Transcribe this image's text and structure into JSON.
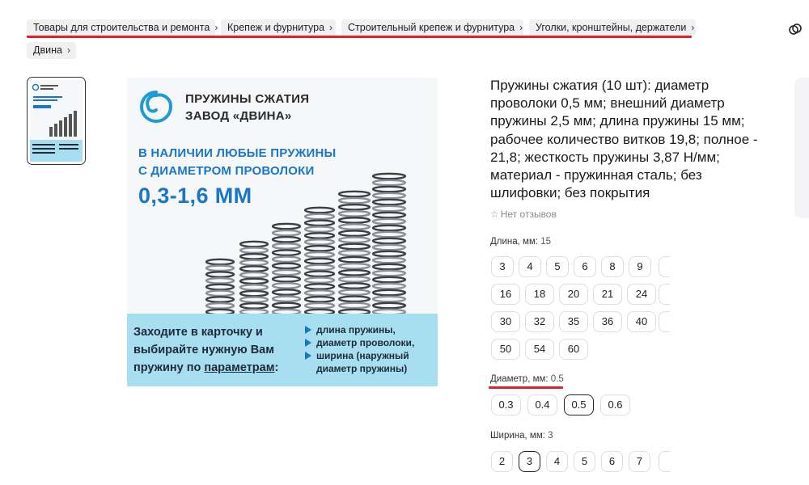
{
  "breadcrumbs": [
    {
      "label": "Товары для строительства и ремонта"
    },
    {
      "label": "Крепеж и фурнитура"
    },
    {
      "label": "Строительный крепеж и фурнитура"
    },
    {
      "label": "Уголки, кронштейны, держатели"
    },
    {
      "label": "Двина"
    }
  ],
  "colors": {
    "underline": "#e0202a",
    "brand_blue": "#1976c8",
    "panel": "#a8dff0"
  },
  "image": {
    "title_line1": "ПРУЖИНЫ СЖАТИЯ",
    "title_line2": "ЗАВОД «ДВИНА»",
    "sub_line1": "В НАЛИЧИИ ЛЮБЫЕ ПРУЖИНЫ",
    "sub_line2": "С ДИАМЕТРОМ ПРОВОЛОКИ",
    "range": "0,3-1,6 ММ",
    "panel_line1": "Заходите в карточку и",
    "panel_line2": "выбирайте нужную Вам",
    "panel_line3a": "пружину по ",
    "panel_line3b": "параметрам",
    "panel_line3c": ":",
    "bullet1": "длина пружины,",
    "bullet2": "диаметр проволоки,",
    "bullet3": "ширина (наружный",
    "bullet3b": "диаметр пружины)"
  },
  "product": {
    "title": "Пружины сжатия (10 шт): диаметр проволоки 0,5 мм; внешний диаметр пружины 2,5 мм; длина пружины 15 мм; рабочее количество витков 19,8; полное - 21,8; жесткость пружины 3,87 Н/мм; материал - пружинная сталь; без шлифовки; без покрытия",
    "reviews": "Нет отзывов"
  },
  "options": {
    "length": {
      "label": "Длина, мм:",
      "value": "15",
      "rows": [
        [
          "3",
          "4",
          "5",
          "6",
          "8",
          "9"
        ],
        [
          "16",
          "18",
          "20",
          "21",
          "24"
        ],
        [
          "30",
          "32",
          "35",
          "36",
          "40"
        ],
        [
          "50",
          "54",
          "60"
        ]
      ]
    },
    "diameter": {
      "label": "Диаметр, мм:",
      "value": "0.5",
      "values": [
        "0.3",
        "0.4",
        "0.5",
        "0.6"
      ],
      "selected": "0.5"
    },
    "width": {
      "label": "Ширина, мм:",
      "value": "3",
      "values": [
        "2",
        "3",
        "4",
        "5",
        "6",
        "7"
      ],
      "selected": "3"
    }
  }
}
